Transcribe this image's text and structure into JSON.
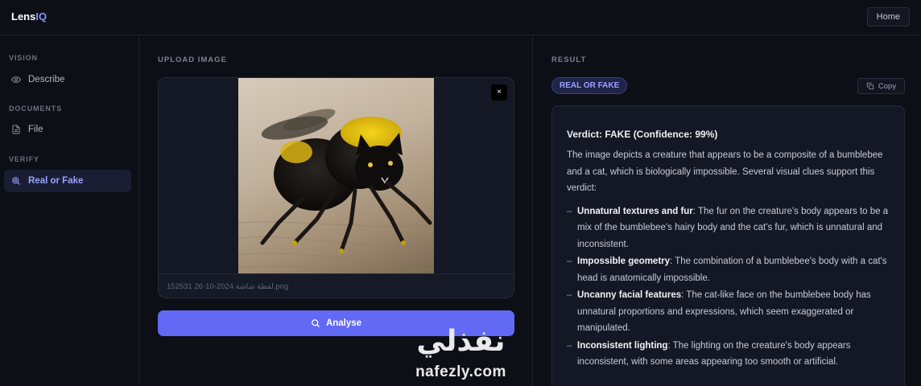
{
  "app": {
    "logo_main": "Lens",
    "logo_accent": "IQ",
    "home_label": "Home"
  },
  "sidebar": {
    "sections": [
      {
        "label": "VISION",
        "items": [
          {
            "label": "Describe",
            "icon": "eye-icon"
          }
        ]
      },
      {
        "label": "DOCUMENTS",
        "items": [
          {
            "label": "File",
            "icon": "file-icon"
          }
        ]
      },
      {
        "label": "VERIFY",
        "items": [
          {
            "label": "Real or Fake",
            "icon": "search-icon",
            "active": true
          }
        ]
      }
    ]
  },
  "upload": {
    "title": "UPLOAD IMAGE",
    "remove_label": "×",
    "filename": "لقطة شاشة 2024-10-26 152531.png",
    "analyse_label": "Analyse"
  },
  "result": {
    "title": "RESULT",
    "badge": "REAL OR FAKE",
    "copy_label": "Copy",
    "verdict": "Verdict: FAKE (Confidence: 99%)",
    "summary": "The image depicts a creature that appears to be a composite of a bumblebee and a cat, which is biologically impossible. Several visual clues support this verdict:",
    "points": [
      {
        "title": "Unnatural textures and fur",
        "text": ": The fur on the creature's body appears to be a mix of the bumblebee's hairy body and the cat's fur, which is unnatural and inconsistent."
      },
      {
        "title": "Impossible geometry",
        "text": ": The combination of a bumblebee's body with a cat's head is anatomically impossible."
      },
      {
        "title": "Uncanny facial features",
        "text": ": The cat-like face on the bumblebee body has unnatural proportions and expressions, which seem exaggerated or manipulated."
      },
      {
        "title": "Inconsistent lighting",
        "text": ": The lighting on the creature's body appears inconsistent, with some areas appearing too smooth or artificial."
      }
    ]
  },
  "watermark": {
    "arabic": "نفذلي",
    "latin": "nafezly.com"
  },
  "colors": {
    "accent": "#6269f4",
    "accent_text": "#9aa2ff",
    "background": "#0d0f16",
    "panel": "#141824"
  }
}
